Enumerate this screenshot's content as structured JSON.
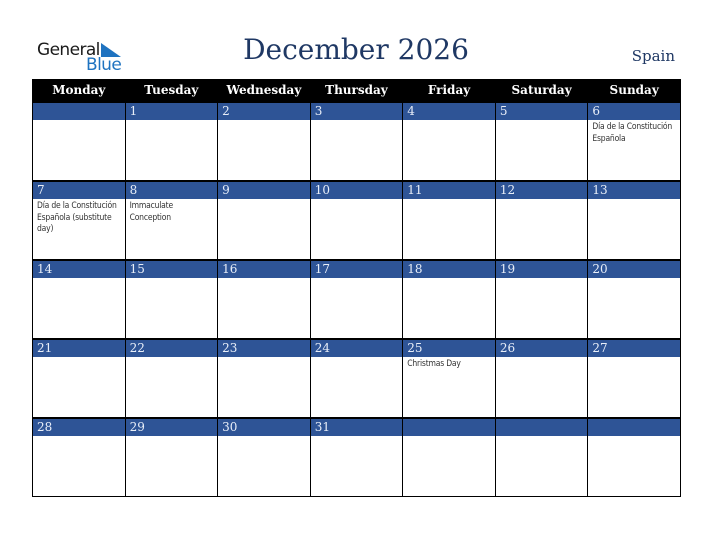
{
  "brand": {
    "word1": "General",
    "word2": "Blue",
    "accent_color": "#1f73c0"
  },
  "title": "December 2026",
  "country": "Spain",
  "colors": {
    "header_bg": "#000000",
    "week_bar": "#2e5496",
    "title": "#1f3864"
  },
  "weekdays": [
    "Monday",
    "Tuesday",
    "Wednesday",
    "Thursday",
    "Friday",
    "Saturday",
    "Sunday"
  ],
  "weeks": [
    {
      "days": [
        {
          "num": "",
          "event": ""
        },
        {
          "num": "1",
          "event": ""
        },
        {
          "num": "2",
          "event": ""
        },
        {
          "num": "3",
          "event": ""
        },
        {
          "num": "4",
          "event": ""
        },
        {
          "num": "5",
          "event": ""
        },
        {
          "num": "6",
          "event": "Día de la Constitución Española"
        }
      ]
    },
    {
      "days": [
        {
          "num": "7",
          "event": "Día de la Constitución Española (substitute day)"
        },
        {
          "num": "8",
          "event": "Immaculate Conception"
        },
        {
          "num": "9",
          "event": ""
        },
        {
          "num": "10",
          "event": ""
        },
        {
          "num": "11",
          "event": ""
        },
        {
          "num": "12",
          "event": ""
        },
        {
          "num": "13",
          "event": ""
        }
      ]
    },
    {
      "days": [
        {
          "num": "14",
          "event": ""
        },
        {
          "num": "15",
          "event": ""
        },
        {
          "num": "16",
          "event": ""
        },
        {
          "num": "17",
          "event": ""
        },
        {
          "num": "18",
          "event": ""
        },
        {
          "num": "19",
          "event": ""
        },
        {
          "num": "20",
          "event": ""
        }
      ]
    },
    {
      "days": [
        {
          "num": "21",
          "event": ""
        },
        {
          "num": "22",
          "event": ""
        },
        {
          "num": "23",
          "event": ""
        },
        {
          "num": "24",
          "event": ""
        },
        {
          "num": "25",
          "event": "Christmas Day"
        },
        {
          "num": "26",
          "event": ""
        },
        {
          "num": "27",
          "event": ""
        }
      ]
    },
    {
      "days": [
        {
          "num": "28",
          "event": ""
        },
        {
          "num": "29",
          "event": ""
        },
        {
          "num": "30",
          "event": ""
        },
        {
          "num": "31",
          "event": ""
        },
        {
          "num": "",
          "event": ""
        },
        {
          "num": "",
          "event": ""
        },
        {
          "num": "",
          "event": ""
        }
      ]
    }
  ]
}
